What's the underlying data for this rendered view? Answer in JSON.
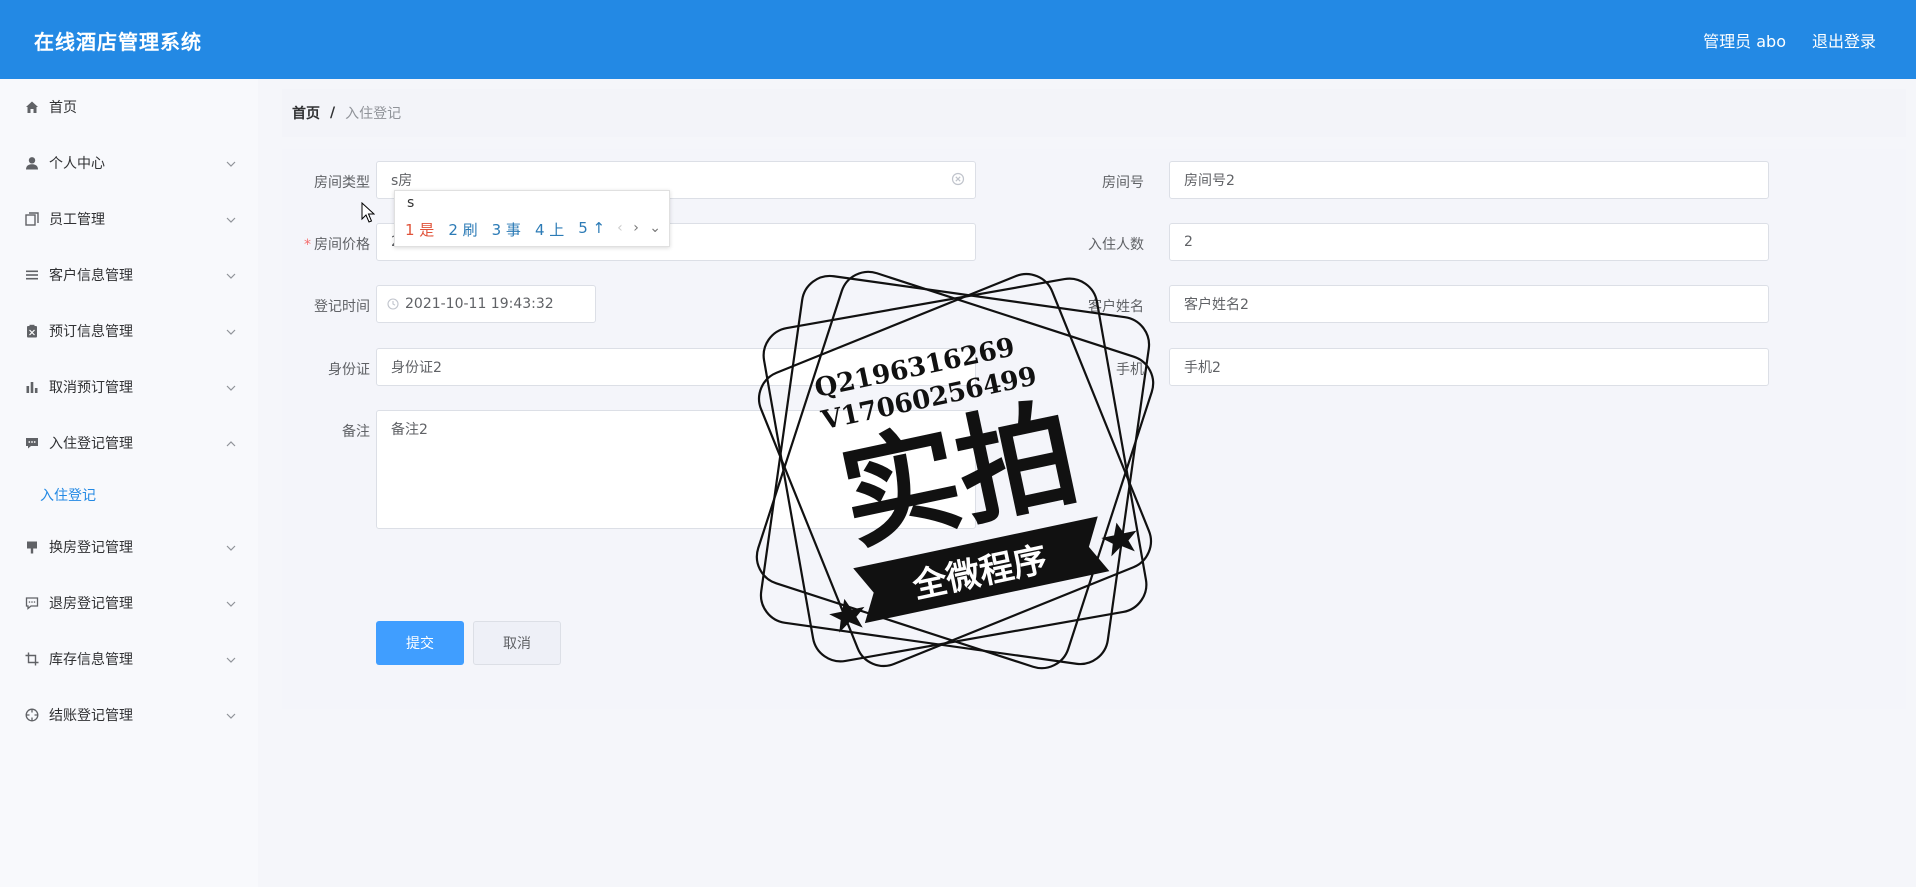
{
  "app": {
    "title": "在线酒店管理系统",
    "user_label": "管理员 abo",
    "logout_label": "退出登录"
  },
  "sidebar": {
    "items": [
      {
        "label": "首页",
        "icon": "home-icon",
        "has_chevron": false
      },
      {
        "label": "个人中心",
        "icon": "user-icon",
        "has_chevron": true
      },
      {
        "label": "员工管理",
        "icon": "copy-icon",
        "has_chevron": true
      },
      {
        "label": "客户信息管理",
        "icon": "menu-icon",
        "has_chevron": true
      },
      {
        "label": "预订信息管理",
        "icon": "clipboard-icon",
        "has_chevron": true
      },
      {
        "label": "取消预订管理",
        "icon": "bar-chart-icon",
        "has_chevron": true
      },
      {
        "label": "入住登记管理",
        "icon": "chat-icon",
        "has_chevron": true,
        "expanded": true
      },
      {
        "label": "换房登记管理",
        "icon": "flag-icon",
        "has_chevron": true
      },
      {
        "label": "退房登记管理",
        "icon": "comment-icon",
        "has_chevron": true
      },
      {
        "label": "库存信息管理",
        "icon": "crop-icon",
        "has_chevron": true
      },
      {
        "label": "结账登记管理",
        "icon": "compass-icon",
        "has_chevron": true
      }
    ],
    "sub_item": "入住登记"
  },
  "breadcrumb": {
    "home": "首页",
    "separator": "/",
    "current": "入住登记"
  },
  "form": {
    "room_type": {
      "label": "房间类型",
      "value": "s房"
    },
    "room_no": {
      "label": "房间号",
      "value": "房间号2"
    },
    "room_price": {
      "label": "房间价格",
      "value": "2"
    },
    "guests": {
      "label": "入住人数",
      "value": "2"
    },
    "checkin_time": {
      "label": "登记时间",
      "value": "2021-10-11 19:43:32"
    },
    "customer_name": {
      "label": "客户姓名",
      "value": "客户姓名2"
    },
    "id_card": {
      "label": "身份证",
      "value": "身份证2"
    },
    "phone": {
      "label": "手机",
      "value": "手机2"
    },
    "remark": {
      "label": "备注",
      "value": "备注2"
    },
    "submit_label": "提交",
    "cancel_label": "取消"
  },
  "ime": {
    "input": "s",
    "candidates": [
      "1 是",
      "2 刷",
      "3 事",
      "4 上",
      "5 ↑"
    ]
  },
  "watermark": {
    "qq": "Q2196316269",
    "phone": "V17060256499",
    "main": "实拍",
    "banner": "全微程序"
  },
  "colors": {
    "header": "#2389e4",
    "primary": "#409eff",
    "active": "#2389e4"
  }
}
